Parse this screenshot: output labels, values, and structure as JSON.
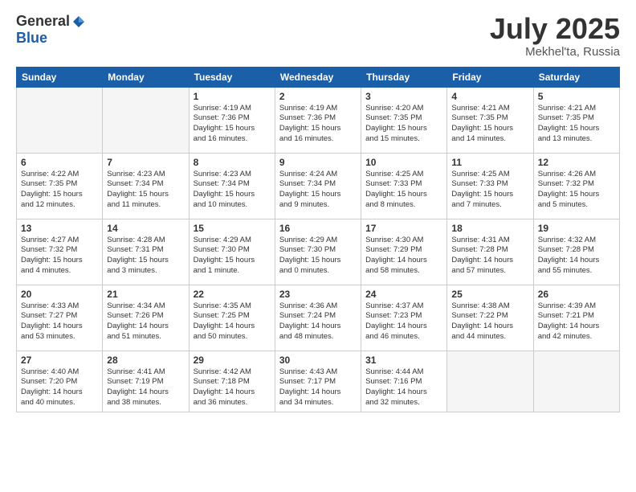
{
  "logo": {
    "general": "General",
    "blue": "Blue"
  },
  "header": {
    "month": "July 2025",
    "location": "Mekhel'ta, Russia"
  },
  "weekdays": [
    "Sunday",
    "Monday",
    "Tuesday",
    "Wednesday",
    "Thursday",
    "Friday",
    "Saturday"
  ],
  "weeks": [
    [
      {
        "day": "",
        "info": ""
      },
      {
        "day": "",
        "info": ""
      },
      {
        "day": "1",
        "info": "Sunrise: 4:19 AM\nSunset: 7:36 PM\nDaylight: 15 hours\nand 16 minutes."
      },
      {
        "day": "2",
        "info": "Sunrise: 4:19 AM\nSunset: 7:36 PM\nDaylight: 15 hours\nand 16 minutes."
      },
      {
        "day": "3",
        "info": "Sunrise: 4:20 AM\nSunset: 7:35 PM\nDaylight: 15 hours\nand 15 minutes."
      },
      {
        "day": "4",
        "info": "Sunrise: 4:21 AM\nSunset: 7:35 PM\nDaylight: 15 hours\nand 14 minutes."
      },
      {
        "day": "5",
        "info": "Sunrise: 4:21 AM\nSunset: 7:35 PM\nDaylight: 15 hours\nand 13 minutes."
      }
    ],
    [
      {
        "day": "6",
        "info": "Sunrise: 4:22 AM\nSunset: 7:35 PM\nDaylight: 15 hours\nand 12 minutes."
      },
      {
        "day": "7",
        "info": "Sunrise: 4:23 AM\nSunset: 7:34 PM\nDaylight: 15 hours\nand 11 minutes."
      },
      {
        "day": "8",
        "info": "Sunrise: 4:23 AM\nSunset: 7:34 PM\nDaylight: 15 hours\nand 10 minutes."
      },
      {
        "day": "9",
        "info": "Sunrise: 4:24 AM\nSunset: 7:34 PM\nDaylight: 15 hours\nand 9 minutes."
      },
      {
        "day": "10",
        "info": "Sunrise: 4:25 AM\nSunset: 7:33 PM\nDaylight: 15 hours\nand 8 minutes."
      },
      {
        "day": "11",
        "info": "Sunrise: 4:25 AM\nSunset: 7:33 PM\nDaylight: 15 hours\nand 7 minutes."
      },
      {
        "day": "12",
        "info": "Sunrise: 4:26 AM\nSunset: 7:32 PM\nDaylight: 15 hours\nand 5 minutes."
      }
    ],
    [
      {
        "day": "13",
        "info": "Sunrise: 4:27 AM\nSunset: 7:32 PM\nDaylight: 15 hours\nand 4 minutes."
      },
      {
        "day": "14",
        "info": "Sunrise: 4:28 AM\nSunset: 7:31 PM\nDaylight: 15 hours\nand 3 minutes."
      },
      {
        "day": "15",
        "info": "Sunrise: 4:29 AM\nSunset: 7:30 PM\nDaylight: 15 hours\nand 1 minute."
      },
      {
        "day": "16",
        "info": "Sunrise: 4:29 AM\nSunset: 7:30 PM\nDaylight: 15 hours\nand 0 minutes."
      },
      {
        "day": "17",
        "info": "Sunrise: 4:30 AM\nSunset: 7:29 PM\nDaylight: 14 hours\nand 58 minutes."
      },
      {
        "day": "18",
        "info": "Sunrise: 4:31 AM\nSunset: 7:28 PM\nDaylight: 14 hours\nand 57 minutes."
      },
      {
        "day": "19",
        "info": "Sunrise: 4:32 AM\nSunset: 7:28 PM\nDaylight: 14 hours\nand 55 minutes."
      }
    ],
    [
      {
        "day": "20",
        "info": "Sunrise: 4:33 AM\nSunset: 7:27 PM\nDaylight: 14 hours\nand 53 minutes."
      },
      {
        "day": "21",
        "info": "Sunrise: 4:34 AM\nSunset: 7:26 PM\nDaylight: 14 hours\nand 51 minutes."
      },
      {
        "day": "22",
        "info": "Sunrise: 4:35 AM\nSunset: 7:25 PM\nDaylight: 14 hours\nand 50 minutes."
      },
      {
        "day": "23",
        "info": "Sunrise: 4:36 AM\nSunset: 7:24 PM\nDaylight: 14 hours\nand 48 minutes."
      },
      {
        "day": "24",
        "info": "Sunrise: 4:37 AM\nSunset: 7:23 PM\nDaylight: 14 hours\nand 46 minutes."
      },
      {
        "day": "25",
        "info": "Sunrise: 4:38 AM\nSunset: 7:22 PM\nDaylight: 14 hours\nand 44 minutes."
      },
      {
        "day": "26",
        "info": "Sunrise: 4:39 AM\nSunset: 7:21 PM\nDaylight: 14 hours\nand 42 minutes."
      }
    ],
    [
      {
        "day": "27",
        "info": "Sunrise: 4:40 AM\nSunset: 7:20 PM\nDaylight: 14 hours\nand 40 minutes."
      },
      {
        "day": "28",
        "info": "Sunrise: 4:41 AM\nSunset: 7:19 PM\nDaylight: 14 hours\nand 38 minutes."
      },
      {
        "day": "29",
        "info": "Sunrise: 4:42 AM\nSunset: 7:18 PM\nDaylight: 14 hours\nand 36 minutes."
      },
      {
        "day": "30",
        "info": "Sunrise: 4:43 AM\nSunset: 7:17 PM\nDaylight: 14 hours\nand 34 minutes."
      },
      {
        "day": "31",
        "info": "Sunrise: 4:44 AM\nSunset: 7:16 PM\nDaylight: 14 hours\nand 32 minutes."
      },
      {
        "day": "",
        "info": ""
      },
      {
        "day": "",
        "info": ""
      }
    ]
  ]
}
